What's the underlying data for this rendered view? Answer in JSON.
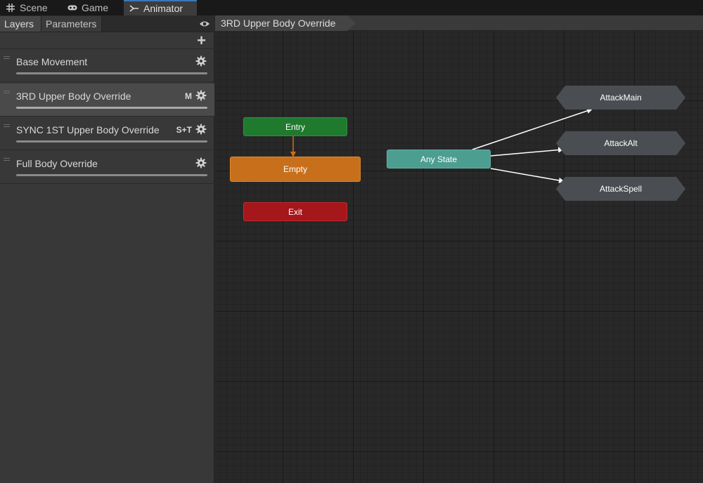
{
  "tabs": [
    {
      "label": "Scene",
      "icon": "grid-icon"
    },
    {
      "label": "Game",
      "icon": "gamepad-icon"
    },
    {
      "label": "Animator",
      "icon": "animator-icon",
      "active": true
    }
  ],
  "left_panel": {
    "subtabs": [
      "Layers",
      "Parameters"
    ],
    "layers": [
      {
        "name": "Base Movement",
        "flag": ""
      },
      {
        "name": "3RD Upper Body Override",
        "flag": "M",
        "selected": true
      },
      {
        "name": "SYNC 1ST Upper Body Override",
        "flag": "S+T"
      },
      {
        "name": "Full Body Override",
        "flag": ""
      }
    ]
  },
  "graph": {
    "breadcrumb": "3RD Upper Body Override",
    "nodes": {
      "entry": "Entry",
      "empty": "Empty",
      "exit": "Exit",
      "any_state": "Any State",
      "sub_a": "AttackMain",
      "sub_b": "AttackAlt",
      "sub_c": "AttackSpell"
    }
  },
  "colors": {
    "entry": "#1f7a2e",
    "default_state": "#c86f1c",
    "exit": "#a5171b",
    "any_state": "#4b9e90",
    "state_machine": "#4a4d52",
    "tab_accent": "#3a79bb"
  }
}
